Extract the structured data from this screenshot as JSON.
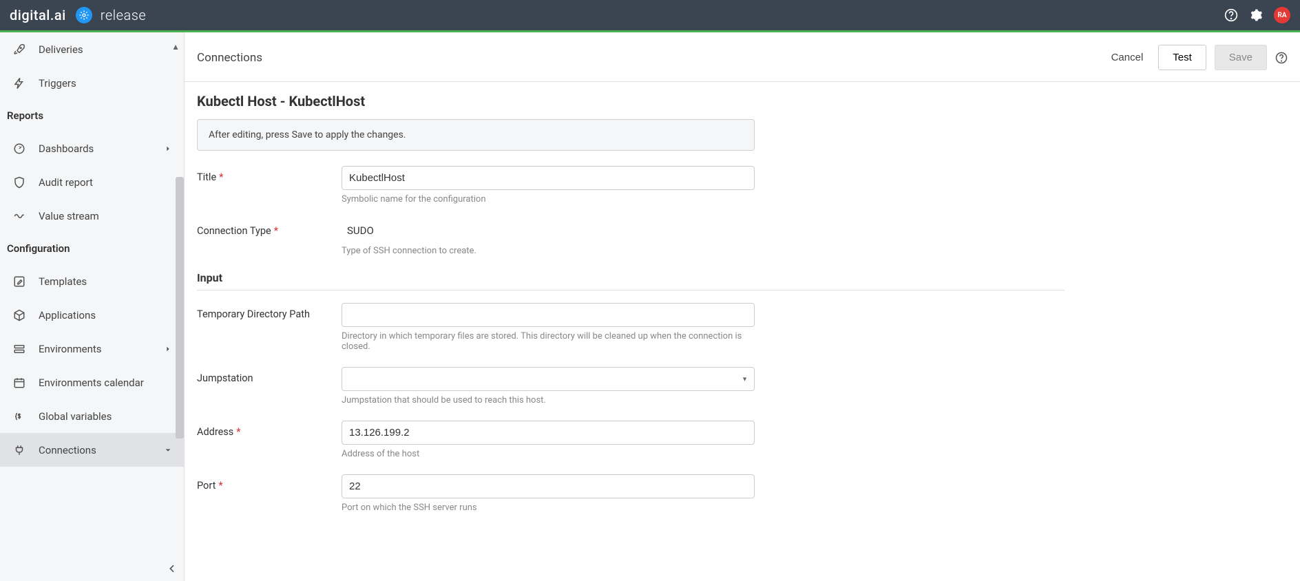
{
  "header": {
    "brand_text": "digital.ai",
    "brand_product": "release",
    "avatar_initials": "RA"
  },
  "sidebar": {
    "items_top": [
      {
        "icon": "rocket",
        "label": "Deliveries"
      },
      {
        "icon": "bolt",
        "label": "Triggers"
      }
    ],
    "section_reports": "Reports",
    "items_reports": [
      {
        "icon": "gauge",
        "label": "Dashboards",
        "chevron": true
      },
      {
        "icon": "shield",
        "label": "Audit report"
      },
      {
        "icon": "wave",
        "label": "Value stream"
      }
    ],
    "section_config": "Configuration",
    "items_config": [
      {
        "icon": "pencil-box",
        "label": "Templates"
      },
      {
        "icon": "cube",
        "label": "Applications"
      },
      {
        "icon": "stack",
        "label": "Environments",
        "chevron": true
      },
      {
        "icon": "calendar",
        "label": "Environments calendar"
      },
      {
        "icon": "dollar-braces",
        "label": "Global variables"
      },
      {
        "icon": "plug",
        "label": "Connections",
        "chevron_down": true,
        "active": true
      }
    ]
  },
  "page": {
    "title": "Connections",
    "cancel": "Cancel",
    "test": "Test",
    "save": "Save",
    "heading": "Kubectl Host - KubectlHost",
    "notice": "After editing, press Save to apply the changes.",
    "section_input": "Input",
    "fields": {
      "title": {
        "label": "Title",
        "value": "KubectlHost",
        "help": "Symbolic name for the configuration",
        "required": true
      },
      "connection_type": {
        "label": "Connection Type",
        "value": "SUDO",
        "help": "Type of SSH connection to create.",
        "required": true
      },
      "tmp_path": {
        "label": "Temporary Directory Path",
        "value": "",
        "help": "Directory in which temporary files are stored. This directory will be cleaned up when the connection is closed."
      },
      "jumpstation": {
        "label": "Jumpstation",
        "value": "",
        "help": "Jumpstation that should be used to reach this host."
      },
      "address": {
        "label": "Address",
        "value": "13.126.199.2",
        "help": "Address of the host",
        "required": true
      },
      "port": {
        "label": "Port",
        "value": "22",
        "help": "Port on which the SSH server runs",
        "required": true
      }
    }
  }
}
